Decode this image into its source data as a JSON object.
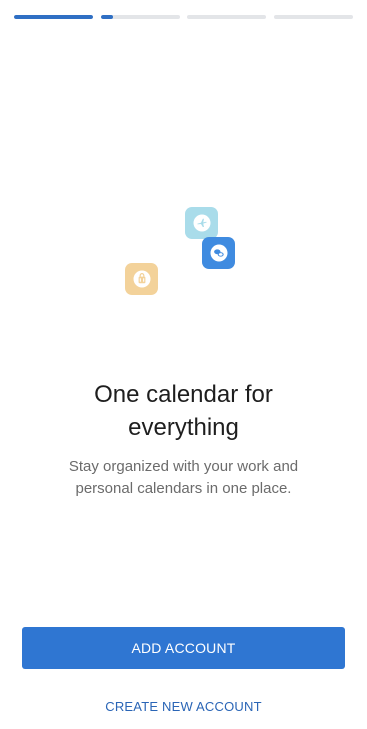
{
  "progress": {
    "segments": [
      1.0,
      0.15,
      0.0,
      0.0
    ],
    "fill_color": "#2f6fc4",
    "track_color": "#e3e5e8"
  },
  "illustration": {
    "icons": [
      {
        "name": "airplane-icon",
        "color": "#a9dcea"
      },
      {
        "name": "chat-bubbles-icon",
        "color": "#3f8be0"
      },
      {
        "name": "shopping-bag-icon",
        "color": "#f3d29a"
      }
    ]
  },
  "onboarding": {
    "title_line1": "One calendar for",
    "title_line2": "everything",
    "subtitle_line1": "Stay organized with your work and",
    "subtitle_line2": "personal calendars in one place."
  },
  "actions": {
    "add_account_label": "ADD ACCOUNT",
    "create_account_label": "CREATE NEW ACCOUNT",
    "primary_color": "#2f76d2"
  }
}
